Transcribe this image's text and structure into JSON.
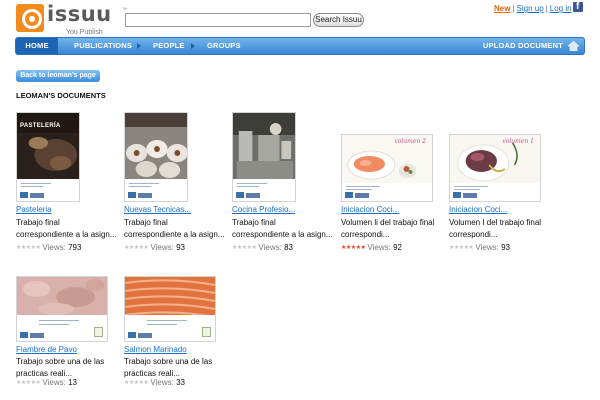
{
  "header": {
    "logo_text": "issuu",
    "logo_tagline": "You Publish",
    "search": {
      "value": "",
      "placeholder": ""
    },
    "search_button": "Search Issuu",
    "links": {
      "new": "New",
      "signup": "Sign up",
      "login": "Log in"
    },
    "facebook_icon": "facebook-icon"
  },
  "nav": {
    "home": "HOME",
    "publications": "PUBLICATIONS",
    "people": "PEOPLE",
    "groups": "GROUPS",
    "upload": "UPLOAD DOCUMENT",
    "upload_icon": "home-upload-icon"
  },
  "back_button": "Back to leoman's page",
  "section_title": "LEOMAN'S DOCUMENTS",
  "views_label": "Views:",
  "documents": [
    {
      "title": "Pasteleria",
      "desc": "Trabajo final correspondiente a la asign...",
      "views": "793",
      "rating": 0,
      "thumb_label": "PASTELERÍA",
      "thumb_theme": "dark-hands"
    },
    {
      "title": "Nuevas Tecnicas...",
      "desc": "Trabajo final correspondiente a la asign...",
      "views": "93",
      "rating": 0,
      "thumb_label": "",
      "thumb_theme": "white-plates"
    },
    {
      "title": "Cocina Profesio...",
      "desc": "Trabajo final correspondiente a la asign...",
      "views": "83",
      "rating": 0,
      "thumb_label": "",
      "thumb_theme": "kitchen"
    },
    {
      "title": "Iniciacion Coci...",
      "desc": "Volumen li del trabajo final correspondi...",
      "views": "92",
      "rating": 5,
      "thumb_label": "volumen 2",
      "thumb_theme": "salmon-plate"
    },
    {
      "title": "Iniciacion Coci...",
      "desc": "Volumen I del trabajo final correspondi...",
      "views": "93",
      "rating": 0,
      "thumb_label": "volumen 1",
      "thumb_theme": "meat-plate"
    },
    {
      "title": "Fiambre de Pavo",
      "desc": "Trabajo sobre una de las practicas reali...",
      "views": "13",
      "rating": 0,
      "thumb_label": "",
      "thumb_theme": "turkey-texture"
    },
    {
      "title": "Salmon Marinado",
      "desc": "Trabajo sobre una de las practicas reali...",
      "views": "33",
      "rating": 0,
      "thumb_label": "",
      "thumb_theme": "salmon-texture"
    }
  ],
  "colors": {
    "brand_orange": "#f28a1c",
    "nav_blue": "#3a86d4",
    "link_blue": "#1b6fc6",
    "new_orange": "#e8650c",
    "star_active": "#e83c22"
  }
}
